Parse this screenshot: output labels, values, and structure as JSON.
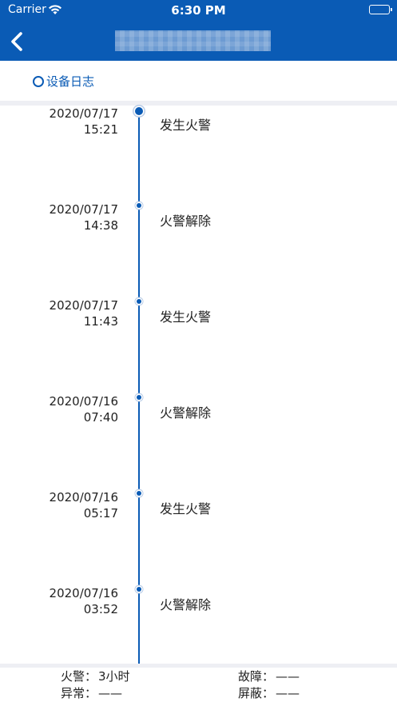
{
  "status_bar": {
    "carrier": "Carrier",
    "time": "6:30 PM"
  },
  "nav": {
    "back_icon": "chevron-left-icon"
  },
  "section": {
    "title": "设备日志"
  },
  "logs": [
    {
      "date": "2020/07/17",
      "time": "15:21",
      "event": "发生火警"
    },
    {
      "date": "2020/07/17",
      "time": "14:38",
      "event": "火警解除"
    },
    {
      "date": "2020/07/17",
      "time": "11:43",
      "event": "发生火警"
    },
    {
      "date": "2020/07/16",
      "time": "07:40",
      "event": "火警解除"
    },
    {
      "date": "2020/07/16",
      "time": "05:17",
      "event": "发生火警"
    },
    {
      "date": "2020/07/16",
      "time": "03:52",
      "event": "火警解除"
    }
  ],
  "summary": {
    "fire_label": "火警：",
    "fire_value": "3小时",
    "fault_label": "故障：",
    "fault_value": "——",
    "abnormal_label": "异常：",
    "abnormal_value": "——",
    "shield_label": "屏蔽：",
    "shield_value": "——"
  },
  "colors": {
    "brand": "#0a5bb5",
    "divider": "#eeeff4"
  }
}
